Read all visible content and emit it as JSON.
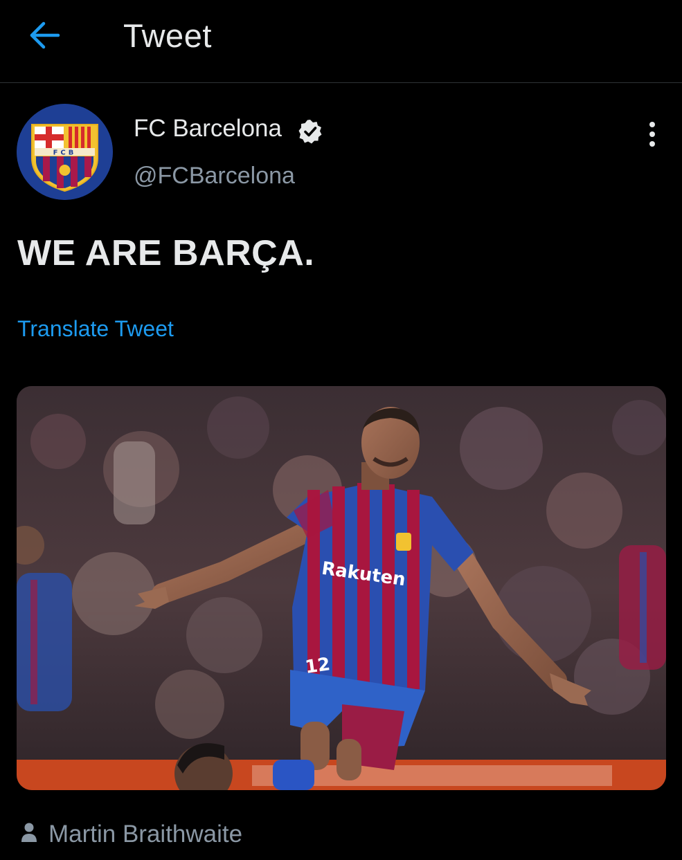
{
  "header": {
    "back_icon": "arrow-left-icon",
    "title": "Tweet"
  },
  "tweet": {
    "author": {
      "display_name": "FC Barcelona",
      "handle": "@FCBarcelona",
      "verified": true,
      "avatar_crest_text": "FCB"
    },
    "text": "WE ARE BARÇA.",
    "translate_label": "Translate Tweet",
    "media": {
      "kind": "photo",
      "sponsor": "Rakuten",
      "shirt_number": "12"
    },
    "tagged_user": "Martin Braithwaite"
  },
  "colors": {
    "background": "#000000",
    "text_primary": "#e7e9ea",
    "text_secondary": "#8b98a5",
    "accent": "#1d9bf0",
    "divider": "#2f3336"
  }
}
